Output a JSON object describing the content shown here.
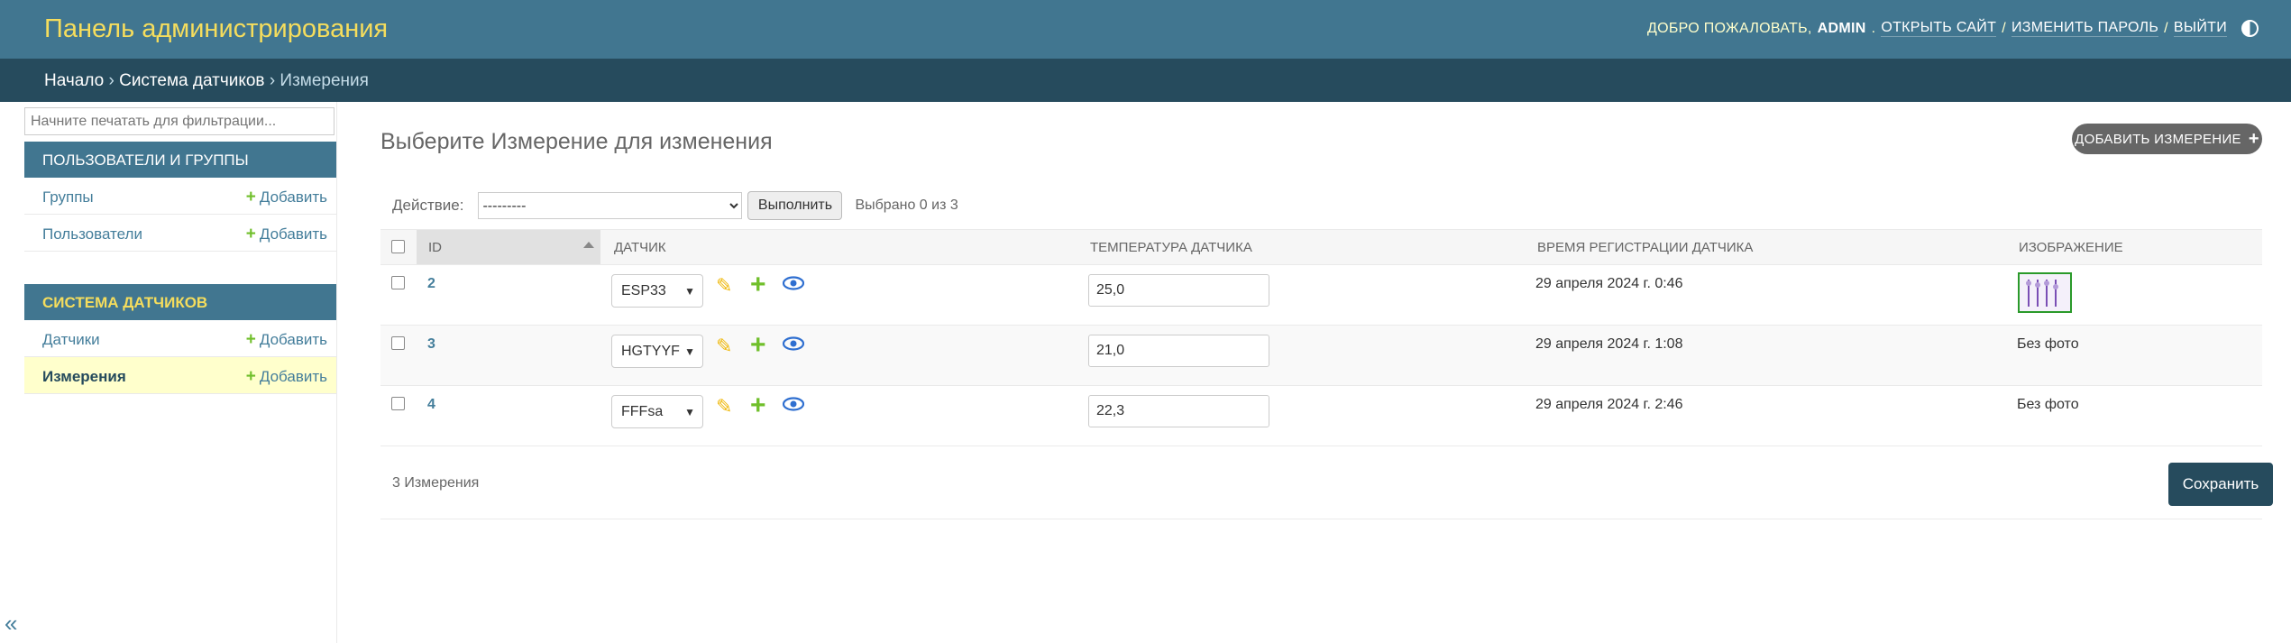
{
  "header": {
    "brand": "Панель администрирования",
    "welcome": "Добро пожаловать,",
    "username": "admin",
    "view_site": "Открыть сайт",
    "separator": "/",
    "change_password": "Изменить пароль",
    "logout": "Выйти",
    "theme_icon": "contrast-icon"
  },
  "breadcrumbs": {
    "home": "Начало",
    "app": "Система датчиков",
    "current": "Измерения",
    "sep": "›"
  },
  "sidebar": {
    "filter_placeholder": "Начните печатать для фильтрации...",
    "modules": [
      {
        "caption": "Пользователи и группы",
        "items": [
          {
            "name": "Группы",
            "add": "Добавить"
          },
          {
            "name": "Пользователи",
            "add": "Добавить"
          }
        ]
      },
      {
        "caption": "Система датчиков",
        "items": [
          {
            "name": "Датчики",
            "add": "Добавить"
          },
          {
            "name": "Измерения",
            "add": "Добавить"
          }
        ]
      }
    ],
    "collapse": "«"
  },
  "content": {
    "title": "Выберите Измерение для изменения",
    "add_button": "Добавить Измерение",
    "action_label": "Действие:",
    "action_value": "---------",
    "go_button": "Выполнить",
    "selected_count": "Выбрано 0 из 3",
    "columns": [
      "ID",
      "Датчик",
      "Температура датчика",
      "Время регистрации датчика",
      "Изображение"
    ],
    "rows": [
      {
        "id": "2",
        "sensor": "ESP33",
        "temperature": "25,0",
        "time": "29 апреля 2024 г. 0:46",
        "image": ""
      },
      {
        "id": "3",
        "sensor": "HGTYYF",
        "temperature": "21,0",
        "time": "29 апреля 2024 г. 1:08",
        "image": "Без фото"
      },
      {
        "id": "4",
        "sensor": "FFFsa",
        "temperature": "22,3",
        "time": "29 апреля 2024 г. 2:46",
        "image": "Без фото"
      }
    ],
    "result_count": "3 Измерения",
    "save_button": "Сохранить"
  },
  "colors": {
    "header_bg": "#417690",
    "breadcrumb_bg": "#264b5d",
    "brand": "#f5dd5d",
    "link": "#447e9b",
    "add_green": "#70bf2b",
    "selected_row": "#ffffcc"
  }
}
